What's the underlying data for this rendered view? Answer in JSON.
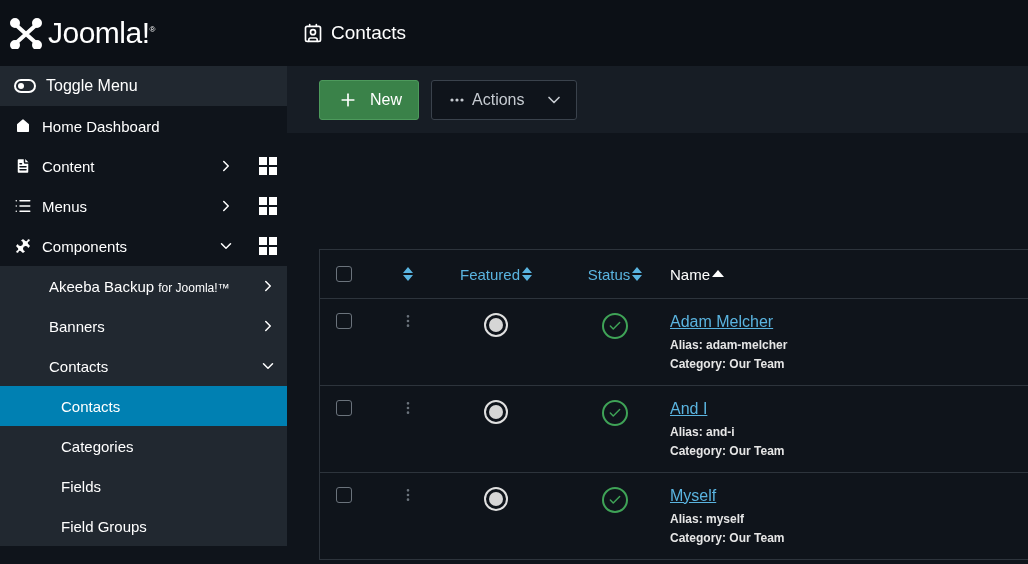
{
  "logo": {
    "text": "Joomla!",
    "mark": "®"
  },
  "page_title": "Contacts",
  "sidebar": {
    "toggle": "Toggle Menu",
    "items": [
      {
        "kind": "top",
        "label": "Home Dashboard",
        "selected": false
      },
      {
        "kind": "top",
        "label": "Content",
        "expanded": false,
        "dashboard": true,
        "selected": false
      },
      {
        "kind": "top",
        "label": "Menus",
        "expanded": false,
        "dashboard": true,
        "selected": false
      },
      {
        "kind": "top",
        "label": "Components",
        "expanded": true,
        "dashboard": true,
        "selected": false
      },
      {
        "kind": "sub",
        "label": "Akeeba Backup",
        "suffix": "for Joomla!™",
        "expanded": false,
        "selected": false
      },
      {
        "kind": "sub",
        "label": "Banners",
        "expanded": false,
        "selected": false
      },
      {
        "kind": "sub",
        "label": "Contacts",
        "expanded": true,
        "selected": false
      },
      {
        "kind": "leaf",
        "label": "Contacts",
        "selected": true
      },
      {
        "kind": "leaf",
        "label": "Categories",
        "selected": false
      },
      {
        "kind": "leaf",
        "label": "Fields",
        "selected": false
      },
      {
        "kind": "leaf",
        "label": "Field Groups",
        "selected": false
      }
    ]
  },
  "toolbar": {
    "new": "New",
    "actions": "Actions"
  },
  "table": {
    "columns": [
      {
        "kind": "check",
        "checked": false
      },
      {
        "kind": "order"
      },
      {
        "kind": "sort",
        "label": "Featured"
      },
      {
        "kind": "sort",
        "label": "Status"
      },
      {
        "kind": "asc",
        "label": "Name"
      }
    ],
    "rows": [
      {
        "checked": false,
        "featured": false,
        "published": true,
        "name": "Adam Melcher",
        "alias": "Alias: adam-melcher",
        "category": "Category: Our Team"
      },
      {
        "checked": false,
        "featured": false,
        "published": true,
        "name": "And I",
        "alias": "Alias: and-i",
        "category": "Category: Our Team"
      },
      {
        "checked": false,
        "featured": false,
        "published": true,
        "name": "Myself",
        "alias": "Alias: myself",
        "category": "Category: Our Team"
      }
    ]
  }
}
